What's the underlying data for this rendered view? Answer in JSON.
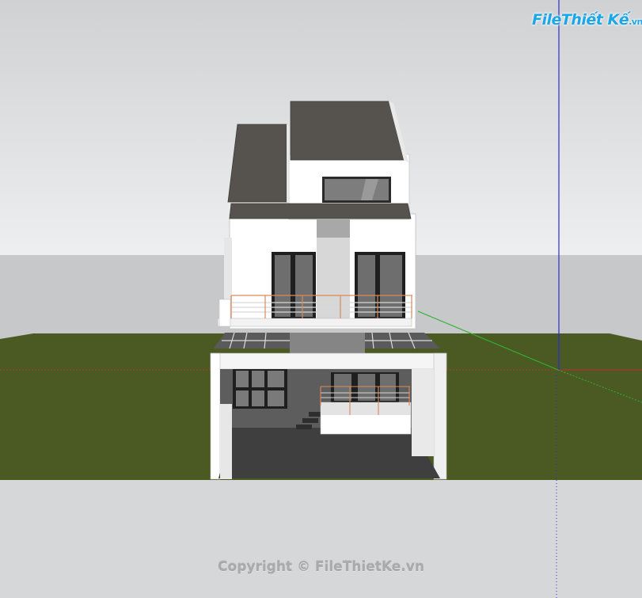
{
  "viewport": {
    "sky_top": "#cfd1d3",
    "sky_bottom": "#eeeff0",
    "grass": "#4b5a23",
    "ground": "#d6d7d8",
    "roof": "#56534f",
    "wall": "#ffffff",
    "axis_red": "#b03a2e",
    "axis_green": "#2fb22f",
    "axis_blue": "#2b2bd6",
    "railing": "#d98a5a"
  },
  "watermark": {
    "logo_main": "File",
    "logo_rest": "Thiết Kế",
    "logo_domain": ".vn",
    "copyright": "Copyright © FileThietKe.vn"
  }
}
